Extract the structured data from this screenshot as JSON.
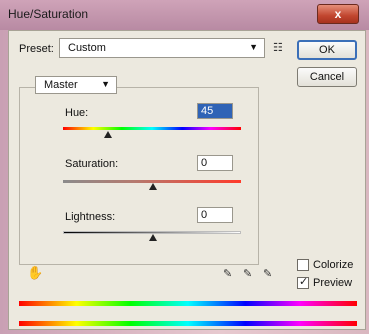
{
  "window": {
    "title": "Hue/Saturation",
    "close_label": "x"
  },
  "preset": {
    "label": "Preset:",
    "value": "Custom",
    "options_icon": "list-icon"
  },
  "buttons": {
    "ok": "OK",
    "cancel": "Cancel"
  },
  "channel": {
    "value": "Master"
  },
  "sliders": {
    "hue": {
      "label": "Hue:",
      "value": "45"
    },
    "saturation": {
      "label": "Saturation:",
      "value": "0"
    },
    "lightness": {
      "label": "Lightness:",
      "value": "0"
    }
  },
  "options": {
    "colorize": {
      "label": "Colorize",
      "checked": false
    },
    "preview": {
      "label": "Preview",
      "checked": true
    }
  },
  "icons": [
    "hand-icon",
    "eyedropper-icon",
    "eyedropper-plus-icon",
    "eyedropper-minus-icon"
  ]
}
